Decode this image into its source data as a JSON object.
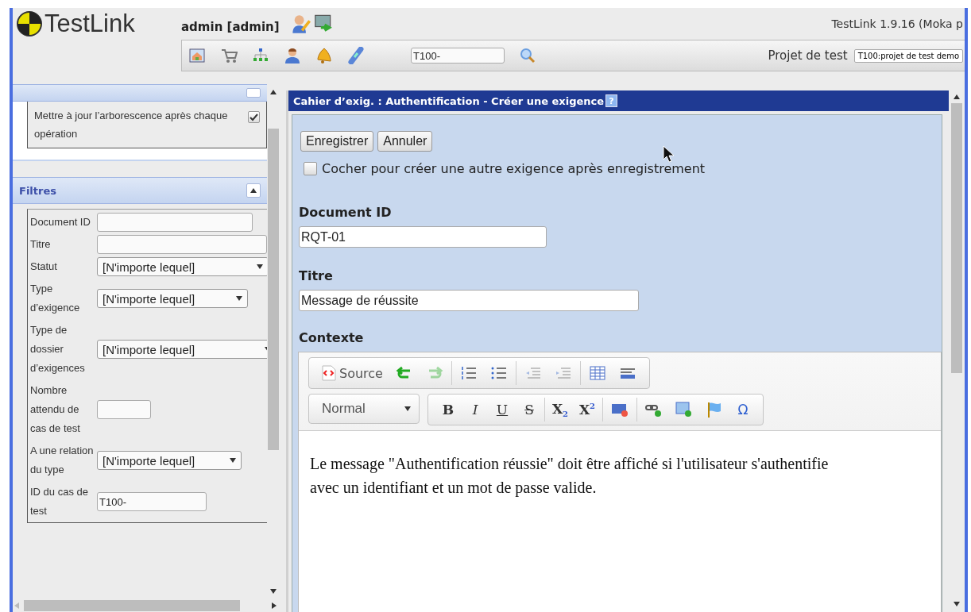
{
  "header": {
    "logo": "TestLink",
    "user": "admin [admin]",
    "version": "TestLink 1.9.16 (Moka p",
    "search_value": "T100-",
    "project_label": "Projet de test",
    "project_value": "T100:projet de test demo"
  },
  "sidebar": {
    "settings": [
      {
        "label": "Mettre à jour l’arborescence après chaque opération",
        "checked": true
      }
    ],
    "filters_title": "Filtres",
    "filters_expanded": true,
    "filters": [
      {
        "label": "Document ID",
        "kind": "input"
      },
      {
        "label": "Titre",
        "kind": "input"
      },
      {
        "label": "Statut",
        "kind": "select",
        "value": "[N'importe lequel]"
      },
      {
        "label": "Type d’exigence",
        "kind": "select",
        "value": "[N'importe lequel]"
      },
      {
        "label": "Type de dossier d’exigences",
        "kind": "select",
        "value": "[N'importe lequel]"
      },
      {
        "label": "Nombre attendu de cas de test",
        "kind": "input"
      },
      {
        "label": "A une relation du type",
        "kind": "select",
        "value": "[N'importe lequel]"
      },
      {
        "label": "ID du cas de test",
        "kind": "input",
        "value": "T100-"
      }
    ]
  },
  "main": {
    "title": "Cahier d’exig. : Authentification - Créer une exigence",
    "help": "?",
    "buttons": [
      "Enregistrer",
      "Annuler"
    ],
    "create_another": {
      "label": "Cocher pour créer une autre exigence après enregistrement",
      "checked": false
    },
    "fields": [
      {
        "label": "Document ID",
        "value": "RQT-01"
      },
      {
        "label": "Titre",
        "value": "Message de réussite"
      }
    ],
    "editor": {
      "label": "Contexte",
      "rows": [
        [
          {
            "kind": "bar",
            "groups": [
              [
                {
                  "kind": "source",
                  "label": "Source"
                },
                {
                  "kind": "icon",
                  "disabled": false
                },
                {
                  "kind": "icon",
                  "disabled": true
                }
              ],
              [
                {
                  "kind": "icon",
                  "disabled": false
                },
                {
                  "kind": "icon",
                  "disabled": false
                }
              ],
              [
                {
                  "kind": "icon",
                  "disabled": true
                },
                {
                  "kind": "icon",
                  "disabled": true
                }
              ],
              [
                {
                  "kind": "icon",
                  "disabled": false
                },
                {
                  "kind": "icon",
                  "disabled": false
                }
              ]
            ]
          }
        ],
        [
          {
            "kind": "combo",
            "value": "Normal"
          },
          {
            "kind": "bar",
            "groups": [
              [
                {
                  "kind": "text",
                  "label": "B"
                },
                {
                  "kind": "text",
                  "label": "I"
                },
                {
                  "kind": "text",
                  "label": "U"
                },
                {
                  "kind": "text",
                  "label": "S"
                }
              ],
              [
                {
                  "kind": "text",
                  "label": "X$_{2}$"
                },
                {
                  "kind": "text",
                  "label": "X$^{2}$"
                }
              ],
              [
                {
                  "kind": "icon",
                  "disabled": false
                }
              ],
              [
                {
                  "kind": "icon",
                  "disabled": false
                },
                {
                  "kind": "icon",
                  "disabled": false
                },
                {
                  "kind": "icon",
                  "disabled": false
                },
                {
                  "kind": "text",
                  "label": "Ω"
                }
              ]
            ]
          }
        ]
      ],
      "content": "Le message \"Authentification réussie\" doit être affiché si l'utilisateur s'authentifie avec un identifiant et un mot de passe valide."
    }
  }
}
